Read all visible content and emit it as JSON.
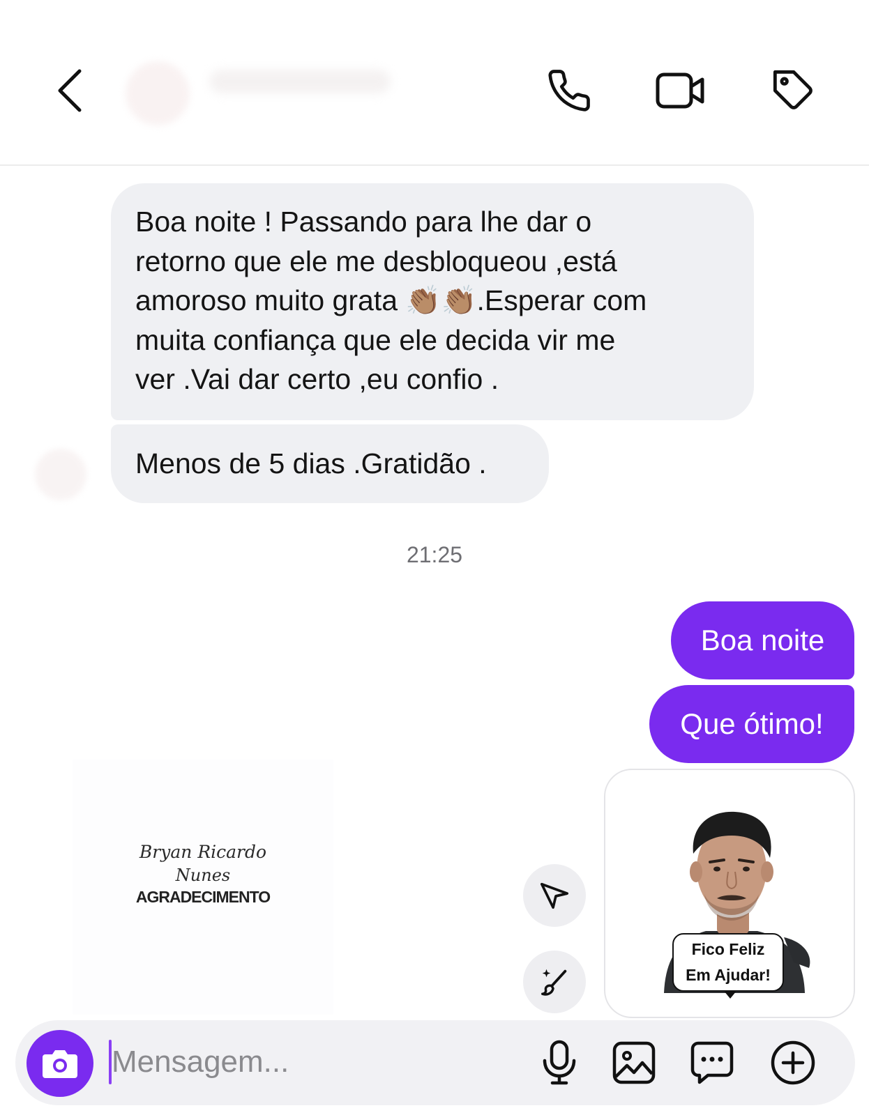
{
  "header": {
    "contact_name": "",
    "icons": {
      "back": "chevron-left-icon",
      "call": "phone-icon",
      "video": "video-camera-icon",
      "tag": "tag-icon"
    }
  },
  "messages": {
    "incoming": [
      {
        "lines": [
          "Boa noite ! Passando para lhe dar o",
          "retorno que ele me desbloqueou ,está",
          "amoroso muito grata 👏🏽👏🏽.Esperar com",
          "muita confiança que ele decida vir me",
          "ver .Vai dar certo ,eu confio ."
        ]
      },
      {
        "text": "Menos de 5 dias .Gratidão ."
      }
    ],
    "timestamp": "21:25",
    "outgoing": [
      {
        "text": "Boa noite"
      },
      {
        "text": "Que ótimo!"
      }
    ],
    "sticker": {
      "caption_line1": "Fico Feliz",
      "caption_line2": "Em Ajudar!"
    }
  },
  "watermark": {
    "script_line1": "Bryan Ricardo",
    "script_line2": "Nunes",
    "title": "AGRADECIMENTO"
  },
  "floating_actions": {
    "share": "send-icon",
    "ai_edit": "magic-brush-icon"
  },
  "composer": {
    "placeholder": "Mensagem...",
    "value": "",
    "icons": [
      "camera-icon",
      "microphone-icon",
      "gallery-icon",
      "chat-bubble-icon",
      "plus-icon"
    ]
  },
  "colors": {
    "accent": "#7A2BEF",
    "incoming_bubble": "#EFF0F3",
    "timestamp": "#6E6E73"
  }
}
